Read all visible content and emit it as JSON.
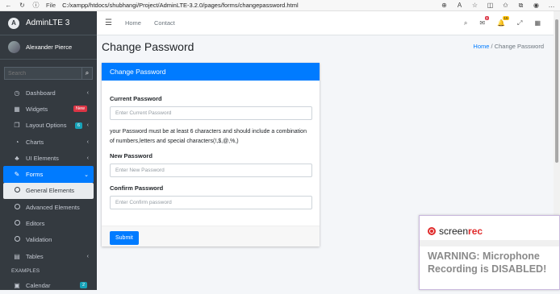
{
  "browser": {
    "file_label": "File",
    "url": "C:/xampp/htdocs/shubhangi/Project/AdminLTE-3.2.0/pages/forms/changepassword.html"
  },
  "sidebar": {
    "brand": "AdminLTE 3",
    "brand_initial": "A",
    "user_name": "Alexander Pierce",
    "search_placeholder": "Search",
    "items": [
      {
        "label": "Dashboard",
        "icon": "dashboard-icon",
        "arrow": "‹"
      },
      {
        "label": "Widgets",
        "icon": "widgets-icon",
        "badge": "New",
        "badge_color": "#dc3545"
      },
      {
        "label": "Layout Options",
        "icon": "copy-icon",
        "badge": "6",
        "badge_color": "#17a2b8",
        "arrow": "‹"
      },
      {
        "label": "Charts",
        "icon": "pie-chart-icon",
        "arrow": "‹"
      },
      {
        "label": "UI Elements",
        "icon": "tree-icon",
        "arrow": "‹"
      },
      {
        "label": "Forms",
        "icon": "edit-icon",
        "arrow": "⌄"
      },
      {
        "label": "General Elements"
      },
      {
        "label": "Advanced Elements"
      },
      {
        "label": "Editors"
      },
      {
        "label": "Validation"
      },
      {
        "label": "Tables",
        "icon": "table-icon",
        "arrow": "‹"
      }
    ],
    "section_header": "EXAMPLES",
    "calendar": {
      "label": "Calendar",
      "badge": "2",
      "badge_color": "#17a2b8"
    }
  },
  "topnav": {
    "home": "Home",
    "contact": "Contact",
    "messages_count": "3",
    "notifications_count": "15"
  },
  "page": {
    "title": "Change Password",
    "breadcrumb_home": "Home",
    "breadcrumb_current": "Change Password"
  },
  "card": {
    "title": "Change Password",
    "current_label": "Current Password",
    "current_placeholder": "Enter Current Password",
    "hint": "your Password must be at least 6 characters and should include a combination of numbers,letters and special characters(!,$,@,%,)",
    "new_label": "New Password",
    "new_placeholder": "Enter New Password",
    "confirm_label": "Confirm Password",
    "confirm_placeholder": "Enter Confirm password",
    "submit": "Submit"
  },
  "overlay": {
    "brand_a": "screen",
    "brand_b": "rec",
    "warning_line1": "WARNING: Microphone",
    "warning_line2": "Recording is DISABLED!"
  },
  "colors": {
    "primary": "#007bff",
    "sidebar": "#343a40"
  }
}
